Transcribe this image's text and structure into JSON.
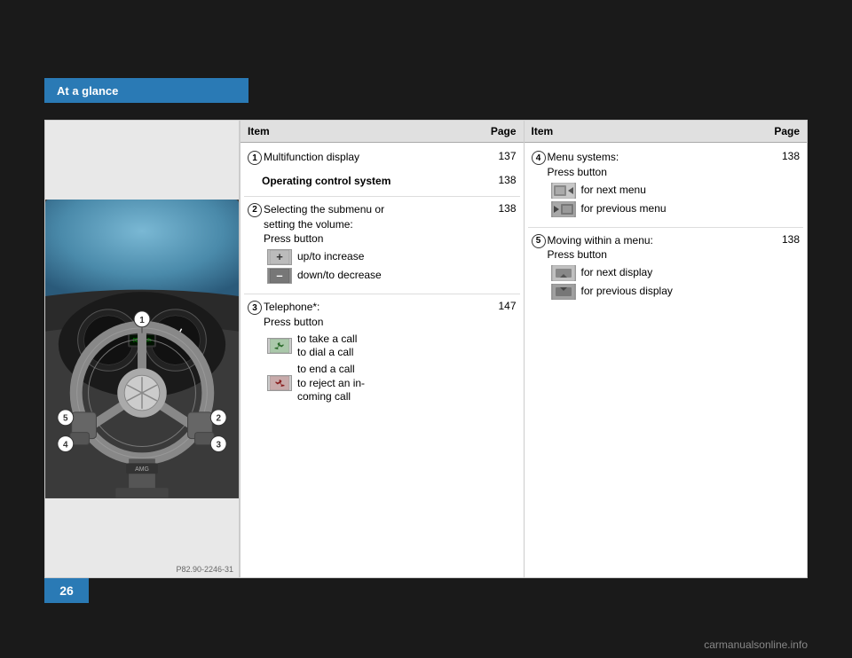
{
  "header": {
    "section_label": "At a glance",
    "page_number": "26"
  },
  "left_table": {
    "columns": {
      "item": "Item",
      "page": "Page"
    },
    "rows": [
      {
        "number": "1",
        "title": "Multifunction display",
        "bold": false,
        "page": "137",
        "sub_items": []
      },
      {
        "number": "",
        "title": "Operating control system",
        "bold": true,
        "page": "138",
        "sub_items": []
      },
      {
        "number": "2",
        "title": "Selecting the submenu or setting the volume: Press button",
        "bold": false,
        "page": "138",
        "sub_items": [
          {
            "icon_type": "plus",
            "label": "up/to increase"
          },
          {
            "icon_type": "minus",
            "label": "down/to decrease"
          }
        ]
      },
      {
        "number": "3",
        "title": "Telephone*: Press button",
        "bold": false,
        "page": "147",
        "sub_items": [
          {
            "icon_type": "phone-green",
            "label": "to take a call\nto dial a call"
          },
          {
            "icon_type": "phone-red",
            "label": "to end a call\nto reject an in-\ncoming call"
          }
        ]
      }
    ]
  },
  "right_table": {
    "columns": {
      "item": "Item",
      "page": "Page"
    },
    "rows": [
      {
        "number": "4",
        "title": "Menu systems: Press button",
        "bold": false,
        "page": "138",
        "sub_items": [
          {
            "icon_type": "menu-next",
            "label": "for next menu"
          },
          {
            "icon_type": "menu-prev",
            "label": "for previous menu"
          }
        ]
      },
      {
        "number": "5",
        "title": "Moving within a menu: Press button",
        "bold": false,
        "page": "138",
        "sub_items": [
          {
            "icon_type": "arrow-up",
            "label": "for next display"
          },
          {
            "icon_type": "arrow-down",
            "label": "for previous display"
          }
        ]
      }
    ]
  },
  "image": {
    "caption": "P82.90-2246-31",
    "alt": "Mercedes-Benz steering wheel with numbered controls"
  },
  "watermark": "carmanualsonline.info"
}
